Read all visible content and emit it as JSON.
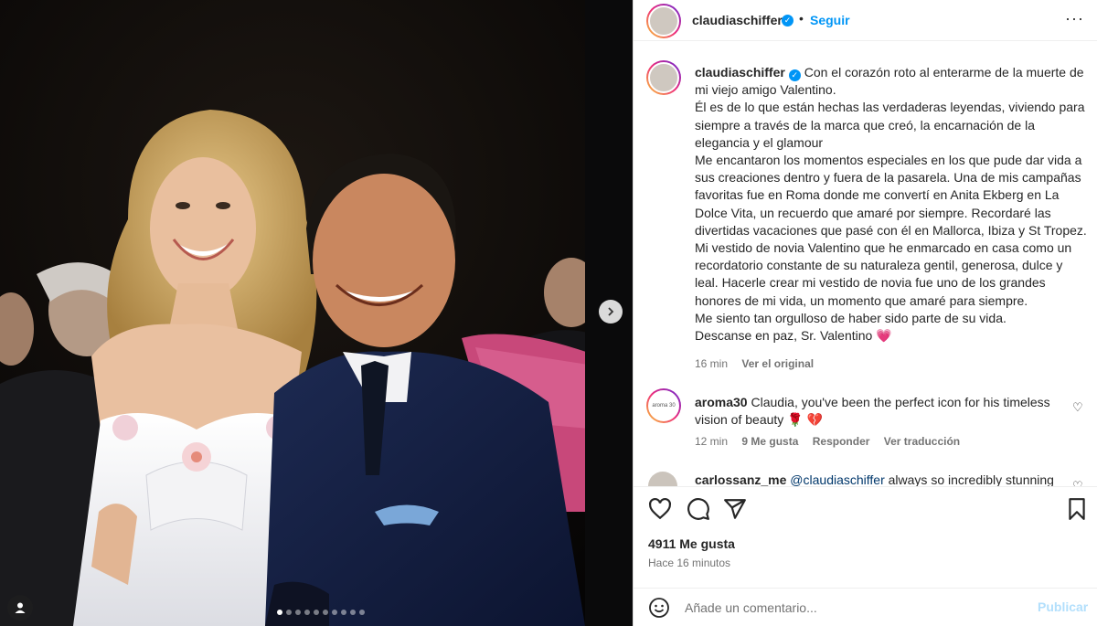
{
  "post": {
    "username": "claudiaschiffer",
    "follow_label": "Seguir",
    "dot_separator": "•",
    "more_label": "···",
    "verified_mark": "✓",
    "caption_lines": [
      "Con el corazón roto al enterarme de la muerte de mi viejo amigo Valentino.",
      "Él es de lo que están hechas las verdaderas leyendas, viviendo para siempre a través de la marca que creó, la encarnación de la elegancia y el glamour",
      "Me encantaron los momentos especiales en los que pude dar vida a sus creaciones dentro y fuera de la pasarela. Una de mis campañas favoritas fue en Roma donde me convertí en Anita Ekberg en La Dolce Vita, un recuerdo que amaré por siempre. Recordaré las divertidas vacaciones que pasé con él en Mallorca, Ibiza y St Tropez. Mi vestido de novia Valentino que he enmarcado en casa como un recordatorio constante de su naturaleza gentil, generosa, dulce y leal. Hacerle crear mi vestido de novia fue uno de los grandes honores de mi vida, un momento que amaré para siempre.",
      "Me siento tan orgulloso de haber sido parte de su vida.",
      "Descanse en paz, Sr. Valentino 💗"
    ],
    "caption_time": "16 min",
    "see_original": "Ver el original",
    "likes": "4911 Me gusta",
    "posted_ago": "Hace 16 minutos"
  },
  "comments": [
    {
      "username": "aroma30",
      "avatar_text": "aroma 30",
      "text": "Claudia, you've been the perfect icon for his timeless vision of beauty 🌹 💔",
      "time": "12 min",
      "likes": "9 Me gusta",
      "reply": "Responder",
      "translate": "Ver traducción"
    },
    {
      "username": "carlossanz_me",
      "mention": "@claudiaschiffer",
      "text": "always so incredibly stunning"
    }
  ],
  "composer": {
    "placeholder": "Añade un comentario...",
    "publish_label": "Publicar"
  },
  "carousel": {
    "total_slides": 10,
    "active_index": 0
  },
  "colors": {
    "accent": "#0095f6",
    "heart": "#e8456b",
    "publish_disabled": "#b2dffc"
  }
}
